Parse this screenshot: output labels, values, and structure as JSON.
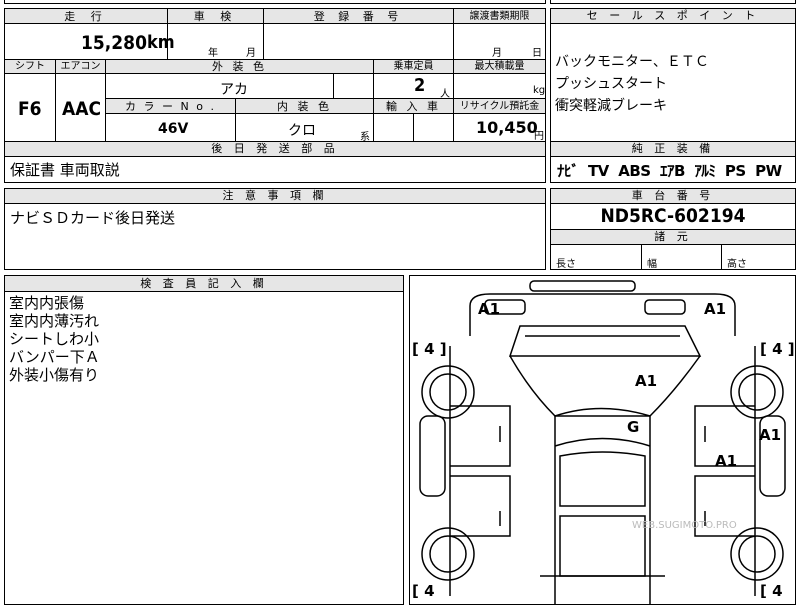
{
  "top": {
    "mileage_label": "走 行",
    "mileage_value": "15,280",
    "mileage_unit": "km",
    "inspection_label": "車 検",
    "inspection_year": "年",
    "inspection_month": "月",
    "registration_label": "登 録 番 号",
    "transfer_label": "譲渡書類期限",
    "transfer_month": "月",
    "transfer_day": "日"
  },
  "row2": {
    "shift_label": "シフト",
    "shift_value": "F6",
    "ac_label": "エアコン",
    "ac_value": "AAC",
    "exterior_label": "外 装 色",
    "exterior_value": "アカ",
    "capacity_label": "乗車定員",
    "capacity_value": "2",
    "capacity_unit": "人",
    "load_label": "最大積載量",
    "load_unit": "kg"
  },
  "row3": {
    "color_no_label": "カ ラ ー N o .",
    "color_no_value": "46V",
    "interior_label": "内 装 色",
    "interior_value": "クロ",
    "interior_unit": "系",
    "import_label": "輸 入 車",
    "recycle_label": "リサイクル預託金",
    "recycle_value": "10,450",
    "recycle_unit": "円"
  },
  "later_parts": {
    "label": "後 日 発 送 部 品",
    "value": "保証書 車両取説"
  },
  "notes": {
    "label": "注 意 事 項 欄",
    "value": "ナビＳＤカード後日発送"
  },
  "sales_points": {
    "label": "セ ー ル ス ポ イ ン ト",
    "lines": [
      "バックモニター、ＥＴＣ",
      "プッシュスタート",
      "衝突軽減ブレーキ"
    ]
  },
  "equipment": {
    "label": "純 正 装 備",
    "value": "ﾅﾋﾞ  TV  ABS  ｴｱB  ｱﾙﾐ  PS  PW"
  },
  "chassis": {
    "label": "車 台 番 号",
    "value": "ND5RC-602194"
  },
  "dimensions": {
    "label": "諸 元",
    "length": "長さ",
    "width": "幅",
    "height": "高さ"
  },
  "inspector": {
    "label": "検 査 員 記 入 欄",
    "lines": [
      "室内内張傷",
      "室内内薄汚れ",
      "シートしわ小",
      "バンパー下Ａ",
      "外装小傷有り"
    ]
  },
  "diagram": {
    "marks": [
      "A1",
      "A1",
      "A1",
      "G",
      "A1",
      "A1",
      "A1"
    ],
    "tire_fl": "[ 4 ]",
    "tire_fr": "[ 4 ]",
    "tire_rl": "[ 4",
    "tire_rr": "[ 4",
    "watermark": "WEB.SUGIMOTO.PRO"
  }
}
